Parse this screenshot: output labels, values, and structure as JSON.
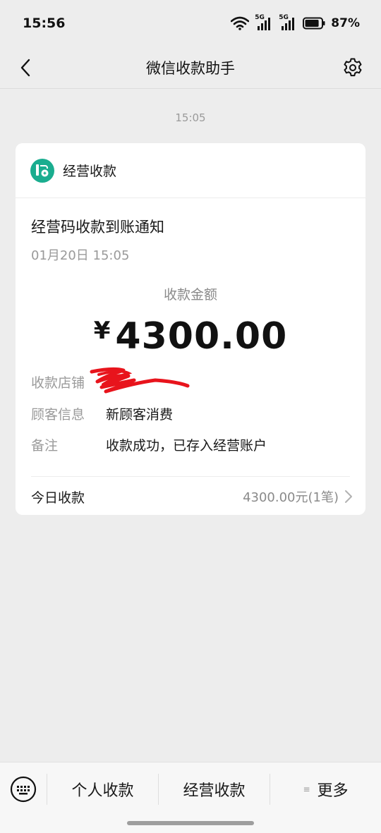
{
  "status_bar": {
    "time": "15:56",
    "signal1_label": "5G",
    "signal2_label": "5G",
    "battery_percent": "87%",
    "battery_level": 0.87,
    "icons": [
      "wifi-icon",
      "signal-5g-icon",
      "signal-5g-icon",
      "battery-icon"
    ]
  },
  "nav": {
    "title": "微信收款助手",
    "back_icon": "chevron-left-icon",
    "settings_icon": "gear-icon"
  },
  "message": {
    "time": "15:05"
  },
  "card": {
    "source_name": "经营收款",
    "source_icon": "business-receipt-icon",
    "accent_color": "#1aad8f",
    "notice_title": "经营码收款到账通知",
    "notice_date": "01月20日 15:05",
    "amount_label": "收款金额",
    "currency_symbol": "¥",
    "amount": "4300.00",
    "rows": [
      {
        "key": "收款店铺",
        "value": ""
      },
      {
        "key": "顾客信息",
        "value": "新顾客消费"
      },
      {
        "key": "备注",
        "value": "收款成功，已存入经营账户"
      }
    ],
    "redaction_color": "#e8141c",
    "today_label": "今日收款",
    "today_value": "4300.00元(1笔)"
  },
  "bottom_bar": {
    "keyboard_icon": "keyboard-icon",
    "items": [
      {
        "label": "个人收款"
      },
      {
        "label": "经营收款"
      },
      {
        "label": "更多"
      }
    ],
    "more_glyph": "≡"
  }
}
